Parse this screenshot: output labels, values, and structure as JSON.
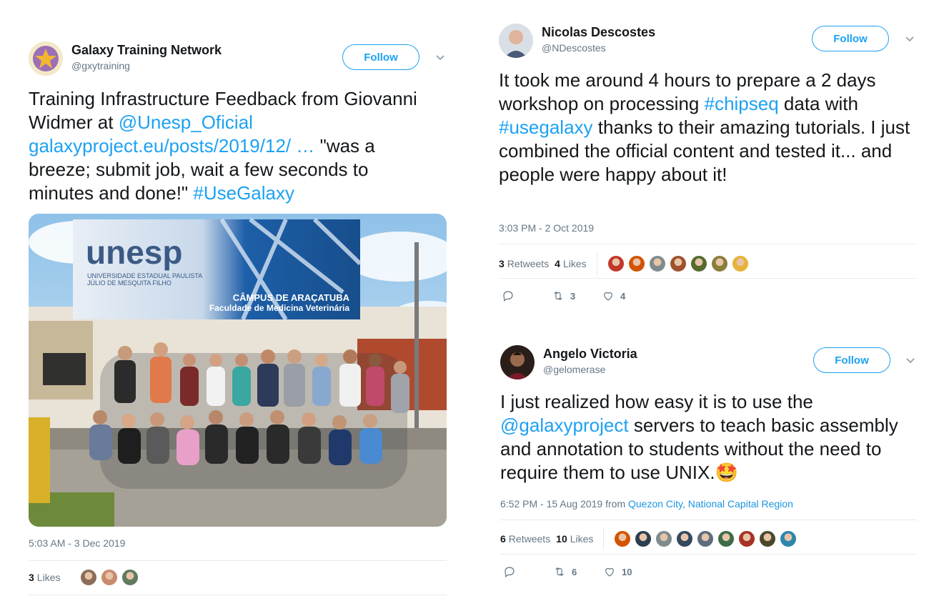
{
  "tweets": [
    {
      "name": "Galaxy Training Network",
      "handle": "@gxytraining",
      "follow_label": "Follow",
      "text": {
        "t1": "Training Infrastructure Feedback from Giovanni Widmer at ",
        "mention": "@Unesp_Oficial",
        "link": "galaxyproject.eu/posts/2019/12/ …",
        "t2": " \"was a breeze; submit job, wait a few seconds to minutes and done!\" ",
        "hashtag": "#UseGalaxy"
      },
      "photo": {
        "sign_brand": "unesp",
        "sign_line1": "UNIVERSIDADE ESTADUAL PAULISTA",
        "sign_line2": "JÚLIO DE MESQUITA FILHO",
        "sign_campus": "CÂMPUS DE ARAÇATUBA",
        "sign_faculty": "Faculdade de Medicina Veterinária"
      },
      "timestamp": "5:03 AM - 3 Dec 2019",
      "likes_count": "3",
      "likes_label": "Likes",
      "liker_colors": [
        "#8a6d5a",
        "#c98a6e",
        "#5f7a5c"
      ]
    },
    {
      "name": "Nicolas Descostes",
      "handle": "@NDescostes",
      "follow_label": "Follow",
      "text": {
        "t1": "It took me around 4 hours to prepare a 2 days workshop on processing ",
        "hashtag1": "#chipseq",
        "t2": " data with ",
        "hashtag2": "#usegalaxy",
        "t3": " thanks to their amazing tutorials. I just combined the official content and tested it... and people were happy about it!"
      },
      "timestamp": "3:03 PM - 2 Oct 2019",
      "retweets_count": "3",
      "retweets_label": "Retweets",
      "likes_count": "4",
      "likes_label": "Likes",
      "engager_colors": [
        "#c0392b",
        "#d35400",
        "#7f8c8d",
        "#a0522d",
        "#556b2f",
        "#8b7d3a",
        "#e8b23a"
      ],
      "reply_count": "",
      "retweet_action_count": "3",
      "like_action_count": "4"
    },
    {
      "name": "Angelo Victoria",
      "handle": "@gelomerase",
      "follow_label": "Follow",
      "text": {
        "t1": "I just realized how easy it is to use the ",
        "mention": "@galaxyproject",
        "t2": " servers to teach basic assembly and annotation to students without the need to require them to use UNIX.",
        "emoji": "🤩"
      },
      "timestamp": "6:52 PM - 15 Aug 2019 from ",
      "location": "Quezon City, National Capital Region",
      "retweets_count": "6",
      "retweets_label": "Retweets",
      "likes_count": "10",
      "likes_label": "Likes",
      "engager_colors": [
        "#d35400",
        "#2c3e50",
        "#7f8c8d",
        "#34495e",
        "#5d6d7e",
        "#3e6b48",
        "#a93226",
        "#4a4a2a",
        "#2e86ab"
      ],
      "reply_count": "",
      "retweet_action_count": "6",
      "like_action_count": "10"
    }
  ],
  "colors": {
    "accent": "#1da1f2",
    "text": "#14171a",
    "muted": "#657786",
    "divider": "#e6ecf0"
  },
  "icons": {
    "reply": "reply-icon",
    "retweet": "retweet-icon",
    "like": "heart-icon",
    "caret": "chevron-down-icon"
  }
}
